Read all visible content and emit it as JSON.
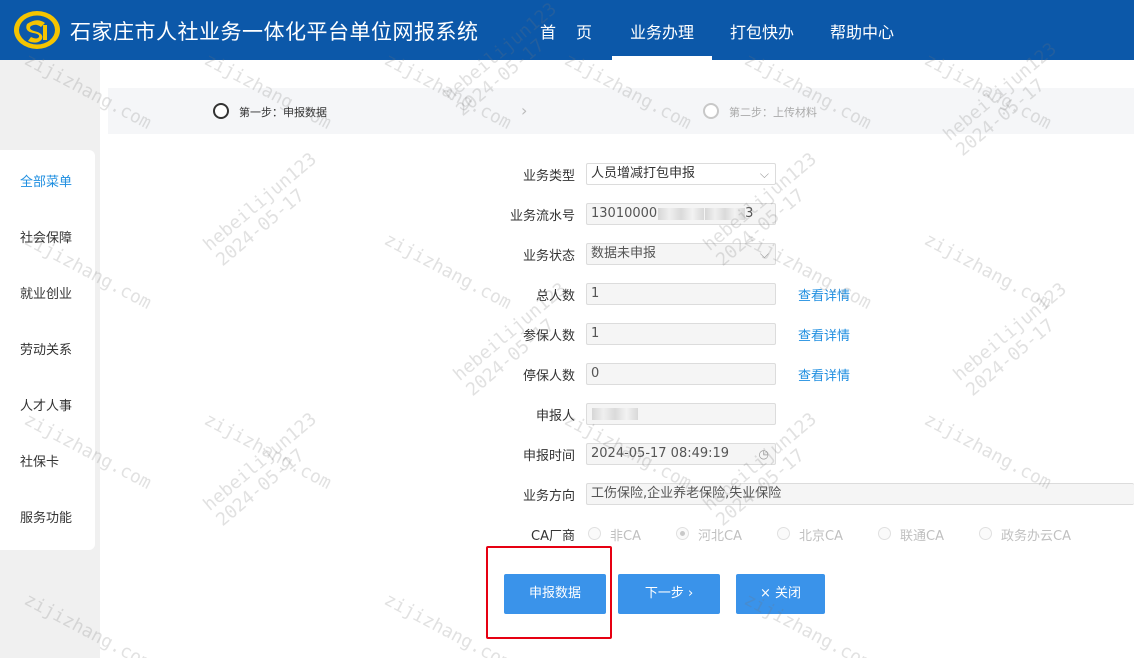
{
  "header": {
    "title": "石家庄市人社业务一体化平台单位网报系统",
    "nav": [
      "首页",
      "业务办理",
      "打包快办",
      "帮助中心"
    ],
    "active_nav": "业务办理"
  },
  "sidebar": {
    "items": [
      "全部菜单",
      "社会保障",
      "就业创业",
      "劳动关系",
      "人才人事",
      "社保卡",
      "服务功能"
    ],
    "active": "全部菜单"
  },
  "steps": {
    "step1": "第一步：申报数据",
    "step2": "第二步：上传材料",
    "arrow": "›"
  },
  "form": {
    "biz_type_label": "业务类型",
    "biz_type_value": "人员增减打包申报",
    "serial_label": "业务流水号",
    "serial_value": "13010000",
    "serial_tail": "3",
    "status_label": "业务状态",
    "status_value": "数据未申报",
    "total_label": "总人数",
    "total_value": "1",
    "insured_label": "参保人数",
    "insured_value": "1",
    "stopped_label": "停保人数",
    "stopped_value": "0",
    "reporter_label": "申报人",
    "time_label": "申报时间",
    "time_value": "2024-05-17 08:49:19",
    "direction_label": "业务方向",
    "direction_value": "工伤保险,企业养老保险,失业保险",
    "ca_label": "CA厂商",
    "ca_options": [
      "非CA",
      "河北CA",
      "北京CA",
      "联通CA",
      "政务办云CA"
    ],
    "ca_selected": "河北CA",
    "detail_link": "查看详情"
  },
  "buttons": {
    "submit": "申报数据",
    "next": "下一步 ›",
    "close": "× 关闭"
  },
  "watermark": {
    "line1": "zijizhang.com",
    "line2": "hebeilijun123",
    "line3": "2024-05-17"
  },
  "colors": {
    "header_bg": "#0c58a9",
    "accent": "#1e8ee0",
    "button": "#3a93ea",
    "highlight": "#e60012"
  }
}
